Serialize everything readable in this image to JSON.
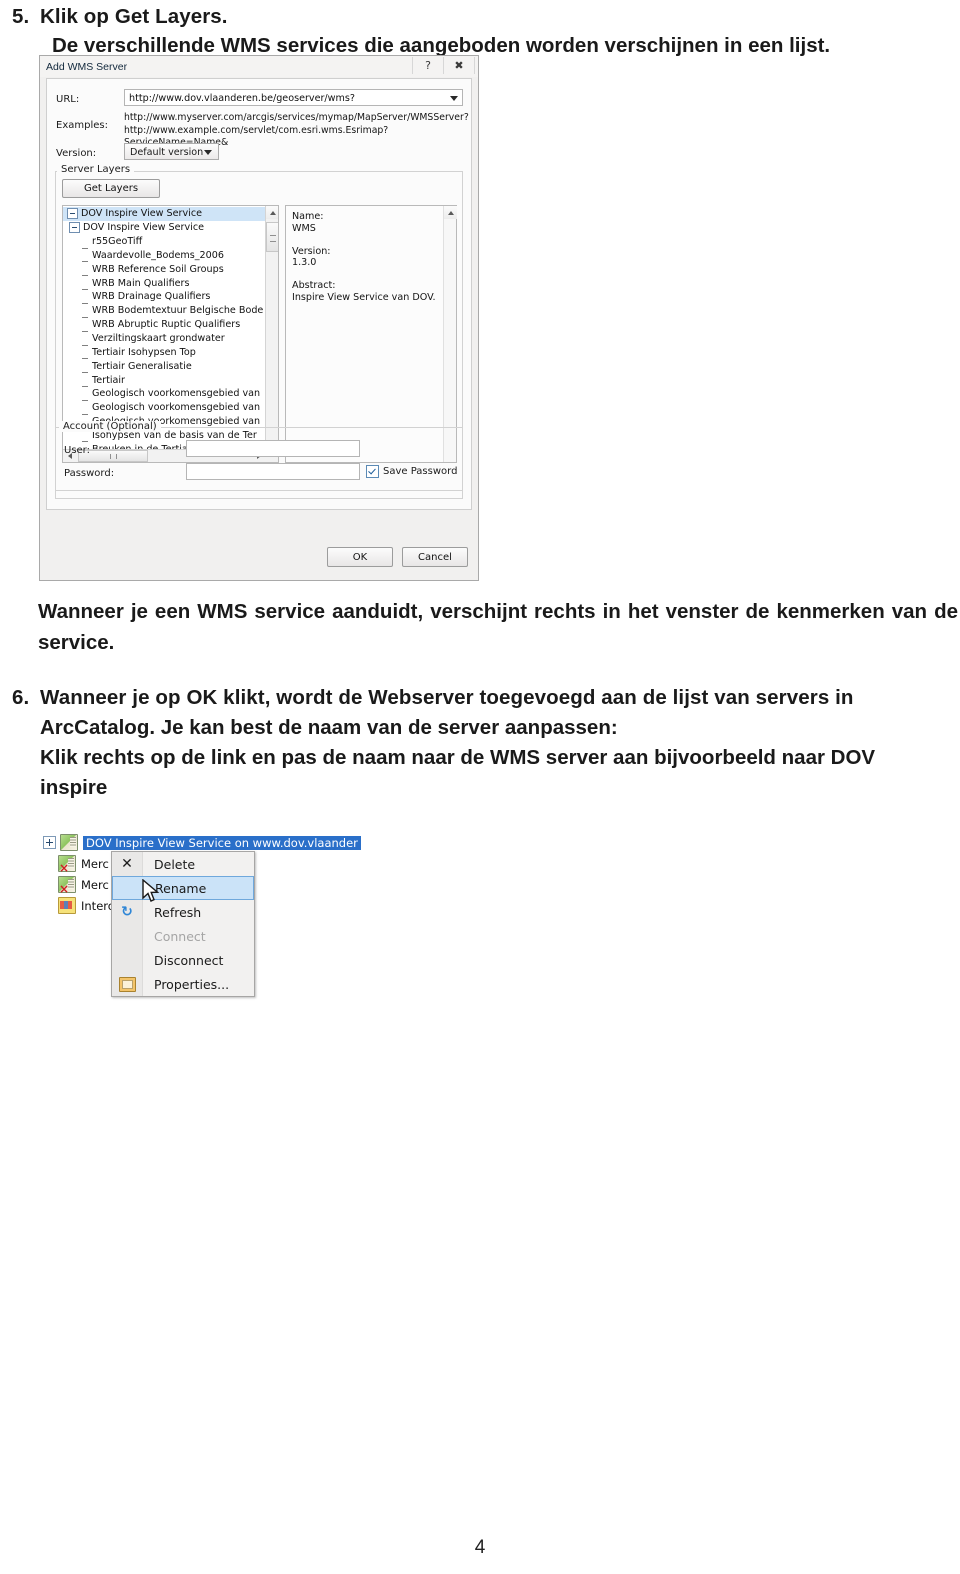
{
  "document": {
    "steps": [
      {
        "number": "5.",
        "title": "Klik op Get Layers.",
        "subtitle": "De verschillende WMS services die aangeboden worden verschijnen in een lijst."
      },
      {
        "number": "6.",
        "line1": "Wanneer je op OK klikt, wordt de Webserver toegevoegd aan de lijst van servers in",
        "line2": "ArcCatalog. Je kan best de naam van de server aanpassen:",
        "line3": "Klik rechts op de link en pas de naam naar de WMS server aan bijvoorbeeld naar DOV",
        "line4": "inspire"
      }
    ],
    "paragraph_after_dialog": "Wanneer je een WMS service aanduidt, verschijnt rechts in het venster de kenmerken van de service.",
    "page_number": "4"
  },
  "wms_dialog": {
    "title": "Add WMS Server",
    "titlebar_buttons": [
      {
        "name": "help-button",
        "glyph": "?"
      },
      {
        "name": "close-button",
        "glyph": "✖"
      }
    ],
    "url_label": "URL:",
    "url_value": "http://www.dov.vlaanderen.be/geoserver/wms?",
    "examples_label": "Examples:",
    "examples": [
      "http://www.myserver.com/arcgis/services/mymap/MapServer/WMSServer?",
      "http://www.example.com/servlet/com.esri.wms.Esrimap?ServiceName=Name&"
    ],
    "version_label": "Version:",
    "version_value": "Default version",
    "server_layers_group": "Server Layers",
    "get_layers_button": "Get Layers",
    "tree": [
      {
        "label": "DOV Inspire View Service",
        "indent": 0,
        "type": "expanded",
        "selected": true
      },
      {
        "label": "DOV Inspire View Service",
        "indent": 1,
        "type": "expanded",
        "selected": false
      },
      {
        "label": "r55GeoTiff",
        "indent": 2,
        "type": "leaf",
        "selected": false
      },
      {
        "label": "Waardevolle_Bodems_2006",
        "indent": 2,
        "type": "leaf",
        "selected": false
      },
      {
        "label": "WRB Reference Soil Groups",
        "indent": 2,
        "type": "leaf",
        "selected": false
      },
      {
        "label": "WRB Main Qualifiers",
        "indent": 2,
        "type": "leaf",
        "selected": false
      },
      {
        "label": "WRB Drainage Qualifiers",
        "indent": 2,
        "type": "leaf",
        "selected": false
      },
      {
        "label": "WRB Bodemtextuur Belgische Bode",
        "indent": 2,
        "type": "leaf",
        "selected": false
      },
      {
        "label": "WRB Abruptic Ruptic Qualifiers",
        "indent": 2,
        "type": "leaf",
        "selected": false
      },
      {
        "label": "Verziltingskaart grondwater",
        "indent": 2,
        "type": "leaf",
        "selected": false
      },
      {
        "label": "Tertiair Isohypsen Top",
        "indent": 2,
        "type": "leaf",
        "selected": false
      },
      {
        "label": "Tertiair Generalisatie",
        "indent": 2,
        "type": "leaf",
        "selected": false
      },
      {
        "label": "Tertiair",
        "indent": 2,
        "type": "leaf",
        "selected": false
      },
      {
        "label": "Geologisch voorkomensgebied van",
        "indent": 2,
        "type": "leaf",
        "selected": false
      },
      {
        "label": "Geologisch voorkomensgebied van",
        "indent": 2,
        "type": "leaf",
        "selected": false
      },
      {
        "label": "Geologisch voorkomensgebied van",
        "indent": 2,
        "type": "leaf",
        "selected": false
      },
      {
        "label": "Isohypsen van de basis van de Ter",
        "indent": 2,
        "type": "leaf",
        "selected": false
      },
      {
        "label": "Breuken in de Tertiaire Formatie va",
        "indent": 2,
        "type": "leaf",
        "selected": false
      }
    ],
    "details": "Name:\nWMS\n\nVersion:\n1.3.0\n\nAbstract:\nInspire View Service van DOV.",
    "account_group": "Account (Optional)",
    "user_label": "User:",
    "user_value": "",
    "password_label": "Password:",
    "password_value": "",
    "save_password_label": "Save Password",
    "ok_button": "OK",
    "cancel_button": "Cancel"
  },
  "catalog_shot": {
    "tree_rows": [
      {
        "label": "DOV Inspire View Service on www.dov.vlaander",
        "selected": true,
        "icon": "wms-server-icon",
        "expandable": true
      },
      {
        "label": "Merc",
        "selected": false,
        "icon": "wms-server-disconnected-icon",
        "expandable": false
      },
      {
        "label": "Merc",
        "selected": false,
        "icon": "wms-server-disconnected-icon",
        "expandable": false
      },
      {
        "label": "Interoper",
        "selected": false,
        "icon": "interoperability-icon",
        "expandable": false
      }
    ],
    "context_menu": [
      {
        "label": "Delete",
        "icon": "delete-x-icon",
        "state": "normal"
      },
      {
        "label": "Rename",
        "icon": "",
        "state": "highlighted"
      },
      {
        "label": "Refresh",
        "icon": "refresh-icon",
        "state": "normal"
      },
      {
        "label": "Connect",
        "icon": "",
        "state": "disabled"
      },
      {
        "label": "Disconnect",
        "icon": "",
        "state": "normal"
      },
      {
        "label": "Properties...",
        "icon": "properties-icon",
        "state": "normal"
      }
    ]
  },
  "colors": {
    "selection_blue": "#2a6fc9",
    "menu_highlight": "#cbe3f8",
    "tree_selection": "#cfe4f7"
  }
}
